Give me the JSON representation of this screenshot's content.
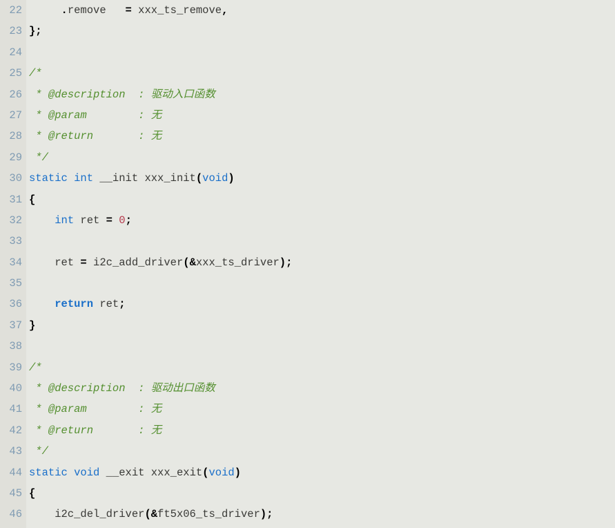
{
  "lines": [
    {
      "num": "22",
      "tokens": [
        {
          "cls": "tok-ident",
          "t": "     "
        },
        {
          "cls": "tok-punct",
          "t": "."
        },
        {
          "cls": "tok-ident",
          "t": "remove   "
        },
        {
          "cls": "tok-op",
          "t": "="
        },
        {
          "cls": "tok-ident",
          "t": " xxx_ts_remove"
        },
        {
          "cls": "tok-punct",
          "t": ","
        }
      ]
    },
    {
      "num": "23",
      "tokens": [
        {
          "cls": "tok-struct",
          "t": "};"
        }
      ]
    },
    {
      "num": "24",
      "tokens": []
    },
    {
      "num": "25",
      "tokens": [
        {
          "cls": "tok-cmt",
          "t": "/*"
        }
      ]
    },
    {
      "num": "26",
      "tokens": [
        {
          "cls": "tok-cmt",
          "t": " * @description  : 驱动入口函数"
        }
      ]
    },
    {
      "num": "27",
      "tokens": [
        {
          "cls": "tok-cmt",
          "t": " * @param        : 无"
        }
      ]
    },
    {
      "num": "28",
      "tokens": [
        {
          "cls": "tok-cmt",
          "t": " * @return       : 无"
        }
      ]
    },
    {
      "num": "29",
      "tokens": [
        {
          "cls": "tok-cmt",
          "t": " */"
        }
      ]
    },
    {
      "num": "30",
      "tokens": [
        {
          "cls": "tok-type",
          "t": "static"
        },
        {
          "cls": "tok-ident",
          "t": " "
        },
        {
          "cls": "tok-type",
          "t": "int"
        },
        {
          "cls": "tok-ident",
          "t": " __init xxx_init"
        },
        {
          "cls": "tok-punct",
          "t": "("
        },
        {
          "cls": "tok-type",
          "t": "void"
        },
        {
          "cls": "tok-punct",
          "t": ")"
        }
      ]
    },
    {
      "num": "31",
      "tokens": [
        {
          "cls": "tok-struct",
          "t": "{"
        }
      ]
    },
    {
      "num": "32",
      "tokens": [
        {
          "cls": "tok-ident",
          "t": "    "
        },
        {
          "cls": "tok-type",
          "t": "int"
        },
        {
          "cls": "tok-ident",
          "t": " ret "
        },
        {
          "cls": "tok-op",
          "t": "="
        },
        {
          "cls": "tok-ident",
          "t": " "
        },
        {
          "cls": "tok-num",
          "t": "0"
        },
        {
          "cls": "tok-punct",
          "t": ";"
        }
      ]
    },
    {
      "num": "33",
      "tokens": []
    },
    {
      "num": "34",
      "tokens": [
        {
          "cls": "tok-ident",
          "t": "    ret "
        },
        {
          "cls": "tok-op",
          "t": "="
        },
        {
          "cls": "tok-ident",
          "t": " i2c_add_driver"
        },
        {
          "cls": "tok-punct",
          "t": "(&"
        },
        {
          "cls": "tok-ident",
          "t": "xxx_ts_driver"
        },
        {
          "cls": "tok-punct",
          "t": ");"
        }
      ]
    },
    {
      "num": "35",
      "tokens": []
    },
    {
      "num": "36",
      "tokens": [
        {
          "cls": "tok-ident",
          "t": "    "
        },
        {
          "cls": "tok-kw",
          "t": "return"
        },
        {
          "cls": "tok-ident",
          "t": " ret"
        },
        {
          "cls": "tok-punct",
          "t": ";"
        }
      ]
    },
    {
      "num": "37",
      "tokens": [
        {
          "cls": "tok-struct",
          "t": "}"
        }
      ]
    },
    {
      "num": "38",
      "tokens": []
    },
    {
      "num": "39",
      "tokens": [
        {
          "cls": "tok-cmt",
          "t": "/*"
        }
      ]
    },
    {
      "num": "40",
      "tokens": [
        {
          "cls": "tok-cmt",
          "t": " * @description  : 驱动出口函数"
        }
      ]
    },
    {
      "num": "41",
      "tokens": [
        {
          "cls": "tok-cmt",
          "t": " * @param        : 无"
        }
      ]
    },
    {
      "num": "42",
      "tokens": [
        {
          "cls": "tok-cmt",
          "t": " * @return       : 无"
        }
      ]
    },
    {
      "num": "43",
      "tokens": [
        {
          "cls": "tok-cmt",
          "t": " */"
        }
      ]
    },
    {
      "num": "44",
      "tokens": [
        {
          "cls": "tok-type",
          "t": "static"
        },
        {
          "cls": "tok-ident",
          "t": " "
        },
        {
          "cls": "tok-type",
          "t": "void"
        },
        {
          "cls": "tok-ident",
          "t": " __exit xxx_exit"
        },
        {
          "cls": "tok-punct",
          "t": "("
        },
        {
          "cls": "tok-type",
          "t": "void"
        },
        {
          "cls": "tok-punct",
          "t": ")"
        }
      ]
    },
    {
      "num": "45",
      "tokens": [
        {
          "cls": "tok-struct",
          "t": "{"
        }
      ]
    },
    {
      "num": "46",
      "tokens": [
        {
          "cls": "tok-ident",
          "t": "    i2c_del_driver"
        },
        {
          "cls": "tok-punct",
          "t": "(&"
        },
        {
          "cls": "tok-ident",
          "t": "ft5x06_ts_driver"
        },
        {
          "cls": "tok-punct",
          "t": ");"
        }
      ]
    }
  ]
}
